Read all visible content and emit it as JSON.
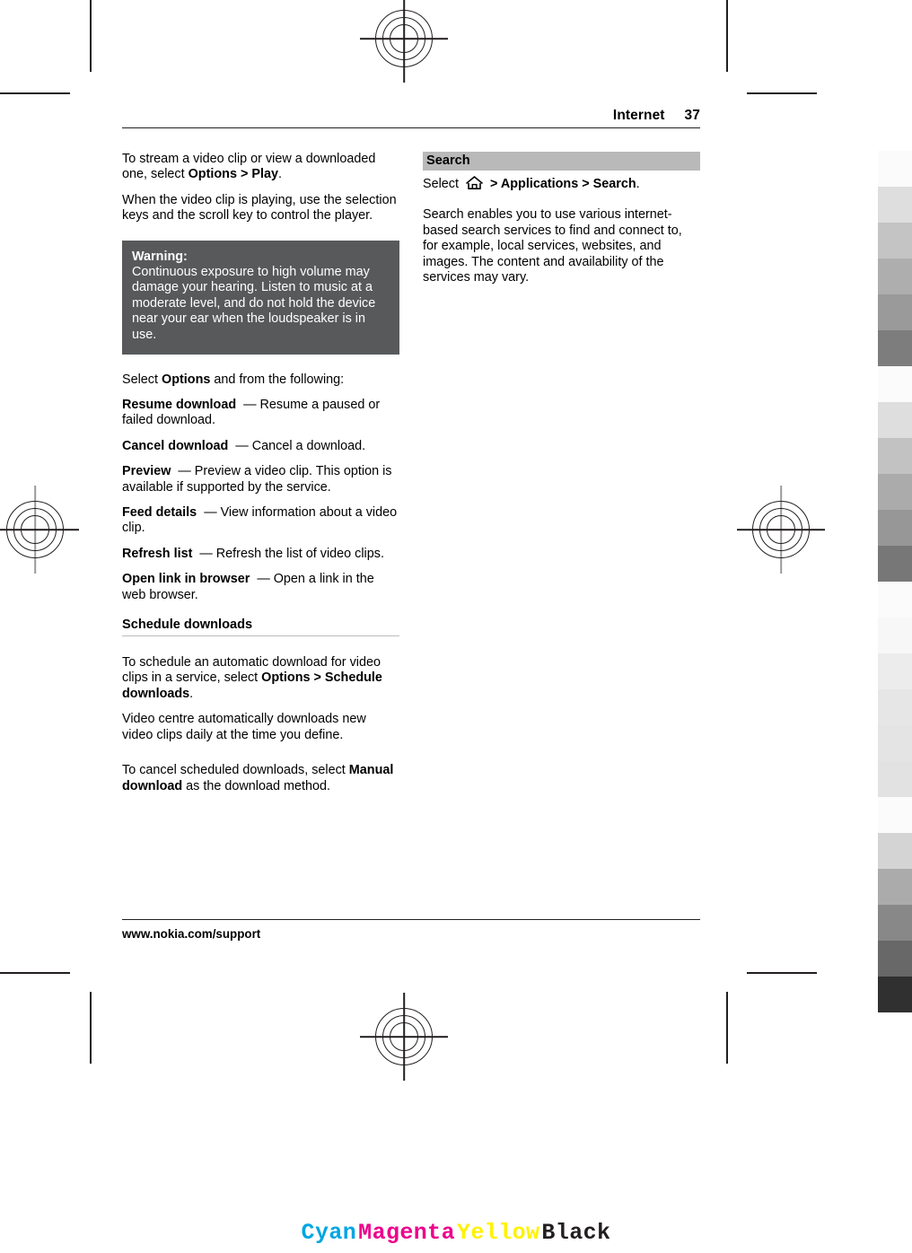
{
  "header": {
    "section_title": "Internet",
    "page_number": "37"
  },
  "left_column": {
    "para_1": {
      "text_a": "To stream a video clip or view a downloaded one, select ",
      "bold_a": "Options",
      "text_b": " > ",
      "bold_b": "Play",
      "text_c": "."
    },
    "para_2": "When the video clip is playing, use the selection keys and the scroll key to control the player.",
    "warning": {
      "title": "Warning:",
      "text": "Continuous exposure to high volume may damage your hearing. Listen to music at a moderate level, and do not hold the device near your ear when the loudspeaker is in use."
    },
    "options_intro": {
      "text_a": "Select ",
      "bold_a": "Options",
      "text_b": " and from the following:"
    },
    "options": [
      {
        "term": "Resume download",
        "dash": "—",
        "definition": "Resume a paused or failed download."
      },
      {
        "term": "Cancel download",
        "dash": "—",
        "definition": "Cancel a download."
      },
      {
        "term": "Preview",
        "dash": "—",
        "definition": "Preview a video clip. This option is available if supported by the service."
      },
      {
        "term": "Feed details",
        "dash": "—",
        "definition": "View information about a video clip."
      },
      {
        "term": "Refresh list",
        "dash": "—",
        "definition": "Refresh the list of video clips."
      },
      {
        "term": "Open link in browser",
        "dash": "—",
        "definition": "Open a link in the web browser."
      }
    ],
    "schedule": {
      "heading": "Schedule downloads",
      "para_1": {
        "text_a": "To schedule an automatic download for video clips in a service, select ",
        "bold_a": "Options",
        "text_b": " > ",
        "bold_b": "Schedule downloads",
        "text_c": "."
      },
      "para_2": "Video centre automatically downloads new video clips daily at the time you define.",
      "para_3": {
        "text_a": "To cancel scheduled downloads, select ",
        "bold_a": "Manual download",
        "text_b": " as the download method."
      }
    }
  },
  "right_column": {
    "search": {
      "heading": "Search",
      "path": {
        "text_a": "Select ",
        "icon": "home-icon",
        "text_b": " > ",
        "bold_a": "Applications",
        "text_c": " > ",
        "bold_b": "Search",
        "text_d": "."
      },
      "body": "Search enables you to use various internet-based search services to find and connect to, for example, local services, websites, and images. The content and availability of the services may vary."
    }
  },
  "footer": {
    "url": "www.nokia.com/support"
  },
  "color_bar": {
    "labels": [
      "Cyan",
      "Magenta",
      "Yellow",
      "Black"
    ],
    "colors": [
      "#00a6e2",
      "#ec008c",
      "#fff200",
      "#231f20"
    ]
  },
  "gray_strip": {
    "bands": [
      "#fbfbfb",
      "#dedede",
      "#c4c4c4",
      "#aeaeae",
      "#9a9a9a",
      "#7d7d7d",
      "#fbfbfb",
      "#dedede",
      "#c2c2c2",
      "#ababab",
      "#979797",
      "#777777",
      "#fbfbfb",
      "#f7f7f7",
      "#ececec",
      "#e6e6e6",
      "#e4e4e4",
      "#e2e2e2",
      "#fbfbfb",
      "#d4d4d4",
      "#ababab",
      "#888888",
      "#686868",
      "#303030"
    ],
    "band_height": 40
  }
}
